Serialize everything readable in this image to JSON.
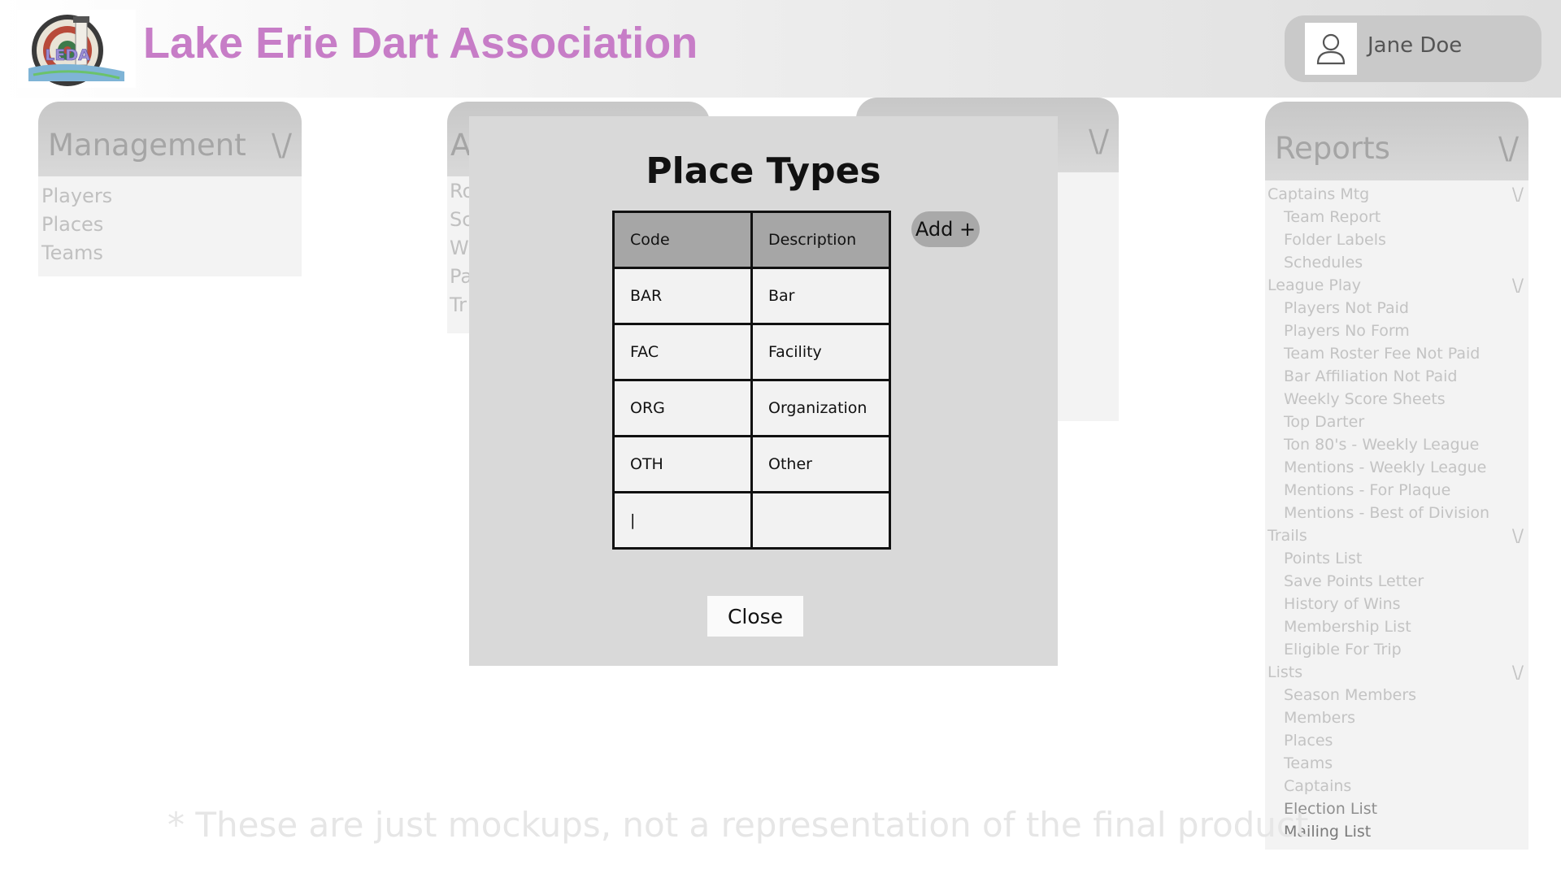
{
  "header": {
    "logo_text": "LEDA",
    "title": "Lake Erie Dart Association",
    "user": {
      "name": "Jane Doe",
      "avatar_icon": "user-icon"
    }
  },
  "panels": {
    "management": {
      "title": "Management",
      "chevron": "\\/",
      "items": [
        "Players",
        "Places",
        "Teams"
      ]
    },
    "second": {
      "title": "A",
      "items": [
        "Ro",
        "Sc",
        "W",
        "Pa",
        "Tr"
      ]
    },
    "third": {
      "chevron": "\\/"
    }
  },
  "reports": {
    "title": "Reports",
    "chevron": "\\/",
    "sections": [
      {
        "label": "Captains Mtg",
        "chevron": "\\/",
        "items": [
          "Team Report",
          "Folder Labels",
          "Schedules"
        ]
      },
      {
        "label": "League Play",
        "chevron": "\\/",
        "items": [
          "Players Not Paid",
          "Players No Form",
          "Team Roster Fee Not Paid",
          " Bar Affiliation Not Paid",
          "Weekly Score Sheets",
          "Top Darter",
          "Ton 80's - Weekly League",
          "Mentions - Weekly League",
          "Mentions - For Plaque",
          "Mentions - Best of Division"
        ]
      },
      {
        "label": "Trails",
        "chevron": "\\/",
        "items": [
          "Points List",
          "Save Points Letter",
          "History of Wins",
          "Membership List",
          "Eligible For Trip"
        ]
      },
      {
        "label": "Lists",
        "chevron": "\\/",
        "items": [
          "Season Members",
          "Members",
          "Places",
          "Teams",
          "Captains",
          "Election List",
          "Mailing List"
        ]
      }
    ]
  },
  "footnote": "*  These are just mockups, not a representation of the final product",
  "modal": {
    "title": "Place Types",
    "add_label": "Add +",
    "close_label": "Close",
    "columns": [
      "Code",
      "Description"
    ],
    "rows": [
      [
        "BAR",
        "Bar"
      ],
      [
        "FAC",
        "Facility"
      ],
      [
        "ORG",
        "Organization"
      ],
      [
        "OTH",
        "Other"
      ],
      [
        "|",
        ""
      ]
    ]
  },
  "colors": {
    "brand": "#c77dc7",
    "modal_bg": "#d9d9d9",
    "table_header": "#a6a6a6",
    "muted_text": "#c0c0c0"
  }
}
